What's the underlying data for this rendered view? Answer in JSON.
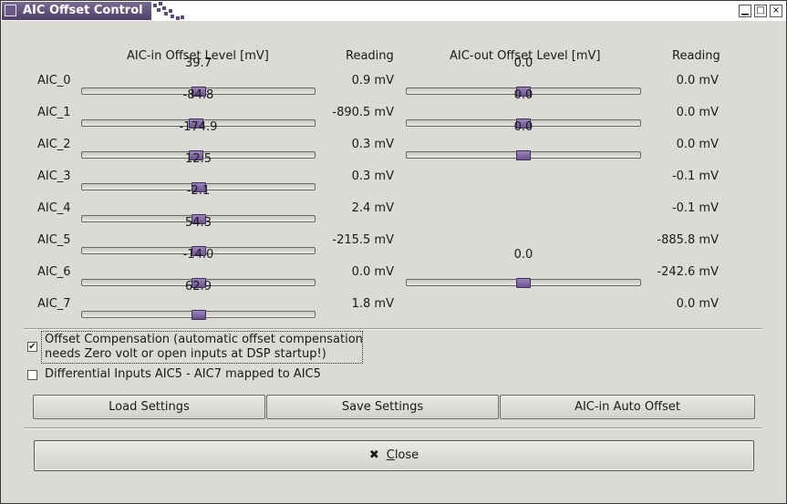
{
  "window": {
    "title": "AIC Offset Control",
    "controls": {
      "minimize": "▁",
      "maximize": "□",
      "close": "×"
    }
  },
  "headers": {
    "aic_in": "AIC-in Offset Level [mV]",
    "reading_in": "Reading",
    "aic_out": "AIC-out Offset Level [mV]",
    "reading_out": "Reading"
  },
  "rows": [
    {
      "label": "AIC_0",
      "in_value": "39.7",
      "in_reading": "0.9 mV",
      "out_value": "0.0",
      "out_reading": "0.0 mV"
    },
    {
      "label": "AIC_1",
      "in_value": "-84.8",
      "in_reading": "-890.5 mV",
      "out_value": "0.0",
      "out_reading": "0.0 mV"
    },
    {
      "label": "AIC_2",
      "in_value": "-174.9",
      "in_reading": "0.3 mV",
      "out_value": "0.0",
      "out_reading": "0.0 mV"
    },
    {
      "label": "AIC_3",
      "in_value": "12.5",
      "in_reading": "0.3 mV",
      "out_value": "",
      "out_reading": "-0.1 mV"
    },
    {
      "label": "AIC_4",
      "in_value": "-2.1",
      "in_reading": "2.4 mV",
      "out_value": "",
      "out_reading": "-0.1 mV"
    },
    {
      "label": "AIC_5",
      "in_value": "54.3",
      "in_reading": "-215.5 mV",
      "out_value": "",
      "out_reading": "-885.8 mV"
    },
    {
      "label": "AIC_6",
      "in_value": "-14.0",
      "in_reading": "0.0 mV",
      "out_value": "0.0",
      "out_reading": "-242.6 mV"
    },
    {
      "label": "AIC_7",
      "in_value": "62.9",
      "in_reading": "1.8 mV",
      "out_value": "",
      "out_reading": "0.0 mV"
    }
  ],
  "in_slider_positions": [
    0.5,
    0.49,
    0.49,
    0.5,
    0.5,
    0.5,
    0.5,
    0.5
  ],
  "out_slider_positions": [
    0.5,
    0.5,
    0.5,
    null,
    null,
    null,
    0.5,
    null
  ],
  "options": {
    "offset_compensation": {
      "label_line1": "Offset Compensation (automatic offset compensation",
      "label_line2": "needs Zero volt or open inputs at DSP startup!)",
      "checked": true
    },
    "differential_inputs": {
      "label": "Differential Inputs AIC5 - AIC7 mapped to AIC5",
      "checked": false
    }
  },
  "buttons": {
    "load": "Load Settings",
    "save": "Save Settings",
    "auto_offset": "AIC-in Auto Offset",
    "close_icon": "✖",
    "close_mnemonic": "C",
    "close_rest": "lose"
  },
  "icons": {
    "close": "x-icon",
    "check": "check-icon"
  },
  "colors": {
    "titlebar": "#5a4a78",
    "slider_thumb": "#7a62a0",
    "background": "#dcdad5"
  }
}
